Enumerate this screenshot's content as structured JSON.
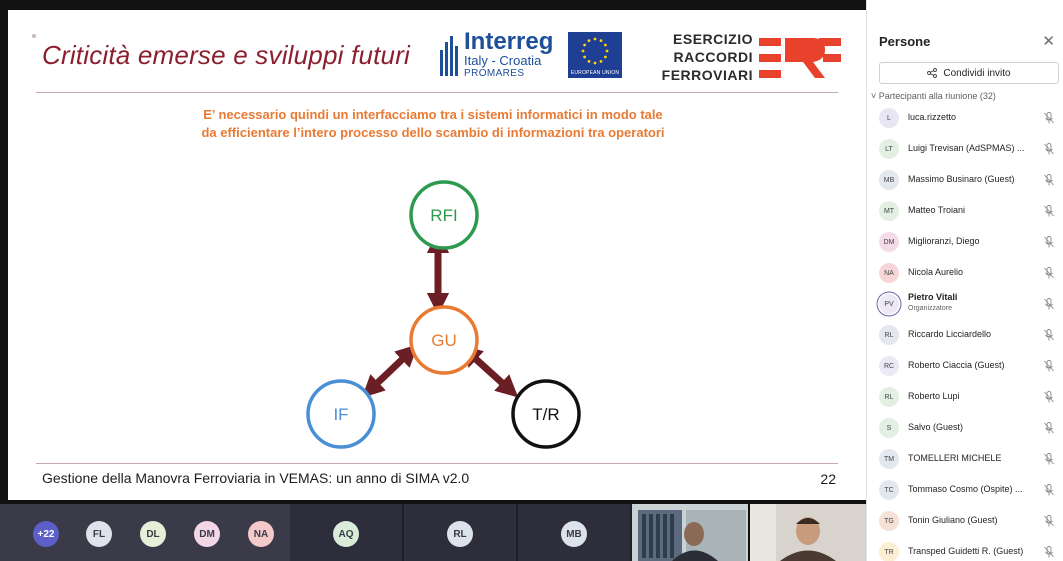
{
  "slide": {
    "title": "Criticità emerse e sviluppi futuri",
    "interreg": {
      "name": "Interreg",
      "region": "Italy - Croatia",
      "project": "PROMARES",
      "eu_label": "EUROPEAN UNION"
    },
    "erf": {
      "line1": "ESERCIZIO",
      "line2": "RACCORDI",
      "line3": "FERROVIARI"
    },
    "body_text": "E’ necessario quindi un interfacciamo tra i sistemi informatici in modo tale da efficientare l’intero processo dello scambio di informazioni tra operatori",
    "diagram": {
      "nodes": [
        {
          "id": "rfi",
          "label": "RFI",
          "color": "#2e9a4f"
        },
        {
          "id": "gu",
          "label": "GU",
          "color": "#e97a33"
        },
        {
          "id": "if",
          "label": "IF",
          "color": "#4a8fd6"
        },
        {
          "id": "tr",
          "label": "T/R",
          "color": "#111111"
        }
      ],
      "arrow_color": "#6b1f24"
    },
    "footer": "Gestione della Manovra Ferroviaria in VEMAS: un anno di SIMA v2.0",
    "page_number": "22"
  },
  "strip": {
    "avatars": [
      {
        "initials": "+22",
        "bg": "#5b5fc7",
        "fg": "#ffffff"
      },
      {
        "initials": "FL",
        "bg": "#dfe4ec",
        "fg": "#3b3a48"
      },
      {
        "initials": "DL",
        "bg": "#e6efd8",
        "fg": "#3b3a48"
      },
      {
        "initials": "DM",
        "bg": "#f2d7e6",
        "fg": "#3b3a48"
      },
      {
        "initials": "NA",
        "bg": "#f4c9c9",
        "fg": "#3b3a48"
      }
    ],
    "tiles": [
      {
        "initials": "AQ",
        "bg": "#d9ecd9"
      },
      {
        "initials": "RL",
        "bg": "#dde3ea"
      },
      {
        "initials": "MB",
        "bg": "#dde3ea"
      }
    ]
  },
  "panel": {
    "title": "Persone",
    "share_label": "Condividi invito",
    "section_label": "Partecipanti alla riunione (32)",
    "participants": [
      {
        "initials": "L",
        "name": "luca.rizzetto",
        "bg": "#e8e6f5"
      },
      {
        "initials": "LT",
        "name": "Luigi Trevisan (AdSPMAS) ...",
        "bg": "#e2efe2"
      },
      {
        "initials": "MB",
        "name": "Massimo Businaro (Guest)",
        "bg": "#e3e8ee"
      },
      {
        "initials": "MT",
        "name": "Matteo Troiani",
        "bg": "#e2efe2"
      },
      {
        "initials": "DM",
        "name": "Miglioranzi, Diego",
        "bg": "#f3dbe8"
      },
      {
        "initials": "NA",
        "name": "Nicola Aurelio",
        "bg": "#f6d6d6"
      },
      {
        "initials": "PV",
        "name": "Pietro Vitali",
        "role": "Organizzatore",
        "bg": "#ece8f6",
        "ring": true
      },
      {
        "initials": "RL",
        "name": "Riccardo Licciardello",
        "bg": "#e3e8ee"
      },
      {
        "initials": "RC",
        "name": "Roberto Ciaccia (Guest)",
        "bg": "#ece8f6"
      },
      {
        "initials": "RL",
        "name": "Roberto Lupi",
        "bg": "#e2efe2"
      },
      {
        "initials": "S",
        "name": "Salvo (Guest)",
        "bg": "#e2efe2"
      },
      {
        "initials": "TM",
        "name": "TOMELLERI MICHELE",
        "bg": "#e3e8ee"
      },
      {
        "initials": "TC",
        "name": "Tommaso Cosmo (Ospite) ...",
        "bg": "#e3e8ee"
      },
      {
        "initials": "TG",
        "name": "Tonin Giuliano (Guest)",
        "bg": "#f6e1d6"
      },
      {
        "initials": "TR",
        "name": "Transped Guidetti R. (Guest)",
        "bg": "#fbeed2"
      }
    ]
  }
}
